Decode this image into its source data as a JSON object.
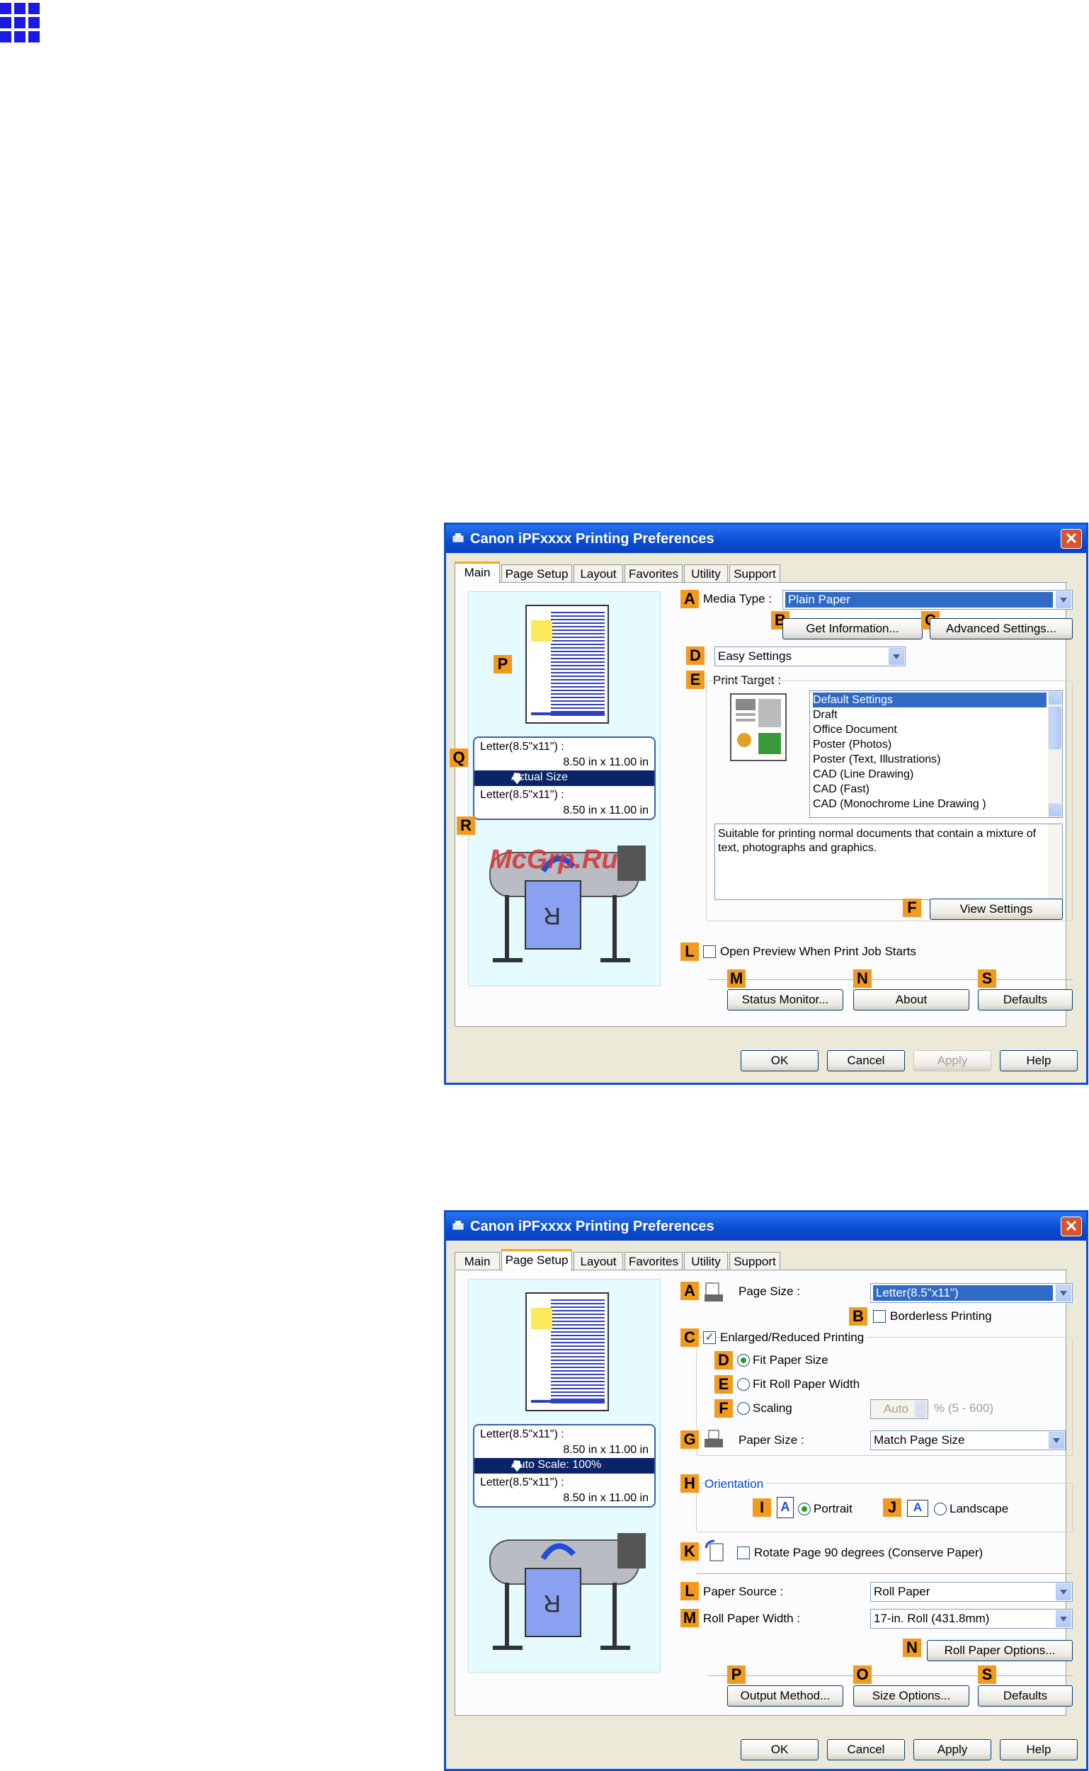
{
  "icon_grid": "blue-grid-icon",
  "dialog_main": {
    "title": "Canon iPFxxxx Printing Preferences",
    "close_glyph": "✕",
    "tabs": [
      "Main",
      "Page Setup",
      "Layout",
      "Favorites",
      "Utility",
      "Support"
    ],
    "active_tab": "Main",
    "preview": {
      "size_line1": "Letter(8.5\"x11\") :",
      "size_line2": "8.50 in x 11.00 in",
      "scale": "Actual Size",
      "size_line3": "Letter(8.5\"x11\") :",
      "size_line4": "8.50 in x 11.00 in"
    },
    "watermark": "McGrp.Ru",
    "letters": {
      "A": "A",
      "B": "B",
      "C": "C",
      "D": "D",
      "E": "E",
      "F": "F",
      "L": "L",
      "M": "M",
      "N": "N",
      "S": "S",
      "P": "P",
      "Q": "Q",
      "R": "R"
    },
    "media_type_label": "Media Type :",
    "media_type_value": "Plain Paper",
    "get_info_button": "Get Information...",
    "advanced_settings_button": "Advanced Settings...",
    "mode_value": "Easy Settings",
    "print_target_label": "Print Target :",
    "print_target_items": [
      "Default Settings",
      "Draft",
      "Office Document",
      "Poster (Photos)",
      "Poster (Text, Illustrations)",
      "CAD (Line Drawing)",
      "CAD (Fast)",
      "CAD (Monochrome Line Drawing )"
    ],
    "print_target_selected": 0,
    "description_line1": "Suitable for printing normal documents that contain a mixture of",
    "description_line2": "text, photographs and graphics.",
    "view_settings_button": "View Settings",
    "open_preview_label": "Open Preview When Print Job Starts",
    "open_preview_checked": false,
    "status_monitor_button": "Status Monitor...",
    "about_button": "About",
    "defaults_button": "Defaults",
    "ok_button": "OK",
    "cancel_button": "Cancel",
    "apply_button": "Apply",
    "help_button": "Help"
  },
  "dialog_page": {
    "title": "Canon iPFxxxx Printing Preferences",
    "close_glyph": "✕",
    "tabs": [
      "Main",
      "Page Setup",
      "Layout",
      "Favorites",
      "Utility",
      "Support"
    ],
    "active_tab": "Page Setup",
    "preview": {
      "size_line1": "Letter(8.5\"x11\") :",
      "size_line2": "8.50 in x 11.00 in",
      "scale": "Auto Scale: 100%",
      "size_line3": "Letter(8.5\"x11\") :",
      "size_line4": "8.50 in x 11.00 in"
    },
    "letters": {
      "A": "A",
      "B": "B",
      "C": "C",
      "D": "D",
      "E": "E",
      "F": "F",
      "G": "G",
      "H": "H",
      "I": "I",
      "J": "J",
      "K": "K",
      "L": "L",
      "M": "M",
      "N": "N",
      "O": "O",
      "P": "P",
      "S": "S"
    },
    "page_size_label": "Page Size :",
    "page_size_value": "Letter(8.5\"x11\")",
    "borderless_label": "Borderless Printing",
    "borderless_checked": false,
    "enlarged_label": "Enlarged/Reduced Printing",
    "enlarged_checked": true,
    "enlarged_checkmark": "✓",
    "fit_paper_label": "Fit Paper Size",
    "fit_roll_label": "Fit Roll Paper Width",
    "scaling_label": "Scaling",
    "scaling_value": "Auto",
    "scaling_unit": "%  (5 - 600)",
    "paper_size_label": "Paper Size :",
    "paper_size_value": "Match Page Size",
    "orientation_label": "Orientation",
    "portrait_label": "Portrait",
    "landscape_label": "Landscape",
    "orientation_glyph": "A",
    "rotate_label": "Rotate Page 90 degrees (Conserve Paper)",
    "rotate_checked": false,
    "paper_source_label": "Paper Source :",
    "paper_source_value": "Roll Paper",
    "roll_width_label": "Roll Paper Width :",
    "roll_width_value": "17-in. Roll (431.8mm)",
    "roll_options_button": "Roll Paper Options...",
    "output_method_button": "Output Method...",
    "size_options_button": "Size Options...",
    "defaults_button": "Defaults",
    "ok_button": "OK",
    "cancel_button": "Cancel",
    "apply_button": "Apply",
    "help_button": "Help"
  }
}
